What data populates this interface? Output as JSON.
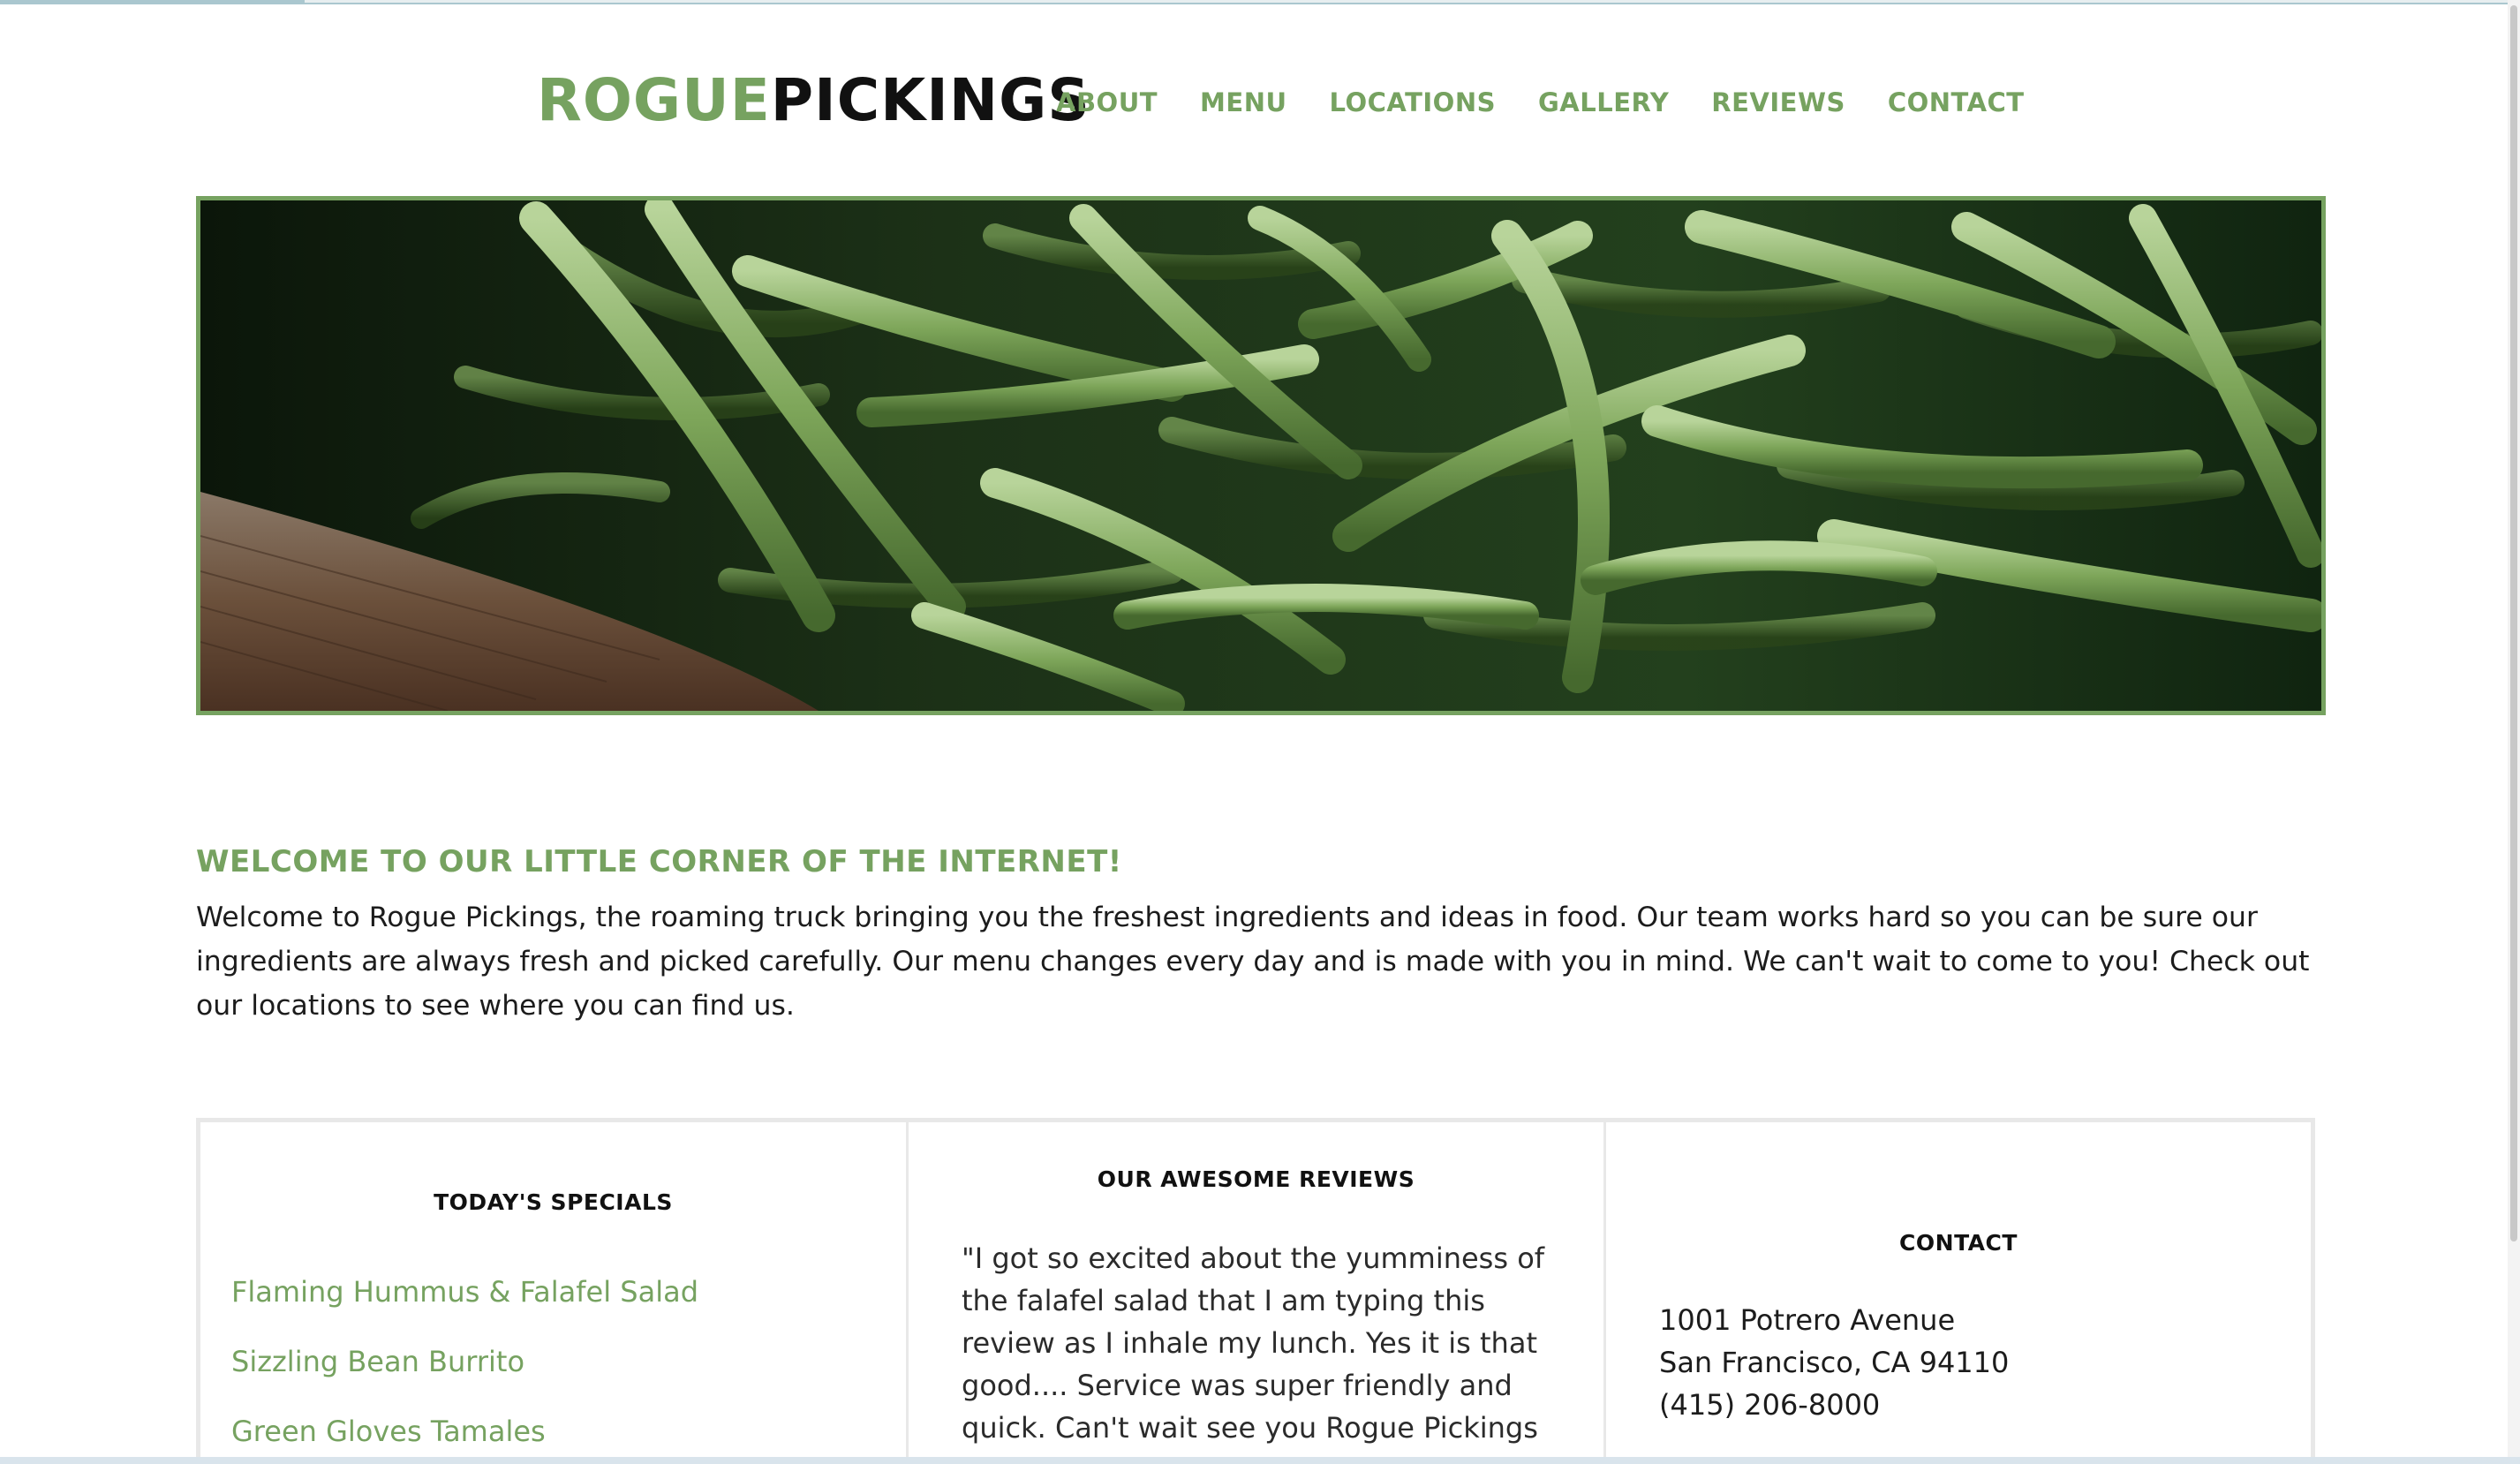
{
  "header": {
    "logo_part1": "ROGUE",
    "logo_part2": "PICKINGS",
    "nav": [
      "ABOUT",
      "MENU",
      "LOCATIONS",
      "GALLERY",
      "REVIEWS",
      "CONTACT"
    ]
  },
  "hero": {
    "image_subject": "green beans in wooden crate"
  },
  "welcome": {
    "title": "WELCOME TO OUR LITTLE CORNER OF THE INTERNET!",
    "body": "Welcome to Rogue Pickings, the roaming truck bringing you the freshest ingredients and ideas in food. Our team works hard so you can be sure our ingredients are always fresh and picked carefully. Our menu changes every day and is made with you in mind. We can't wait to come to you! Check out our locations to see where you can find us."
  },
  "specials": {
    "title": "TODAY'S SPECIALS",
    "items": [
      "Flaming Hummus & Falafel Salad",
      "Sizzling Bean Burrito",
      "Green Gloves Tamales"
    ]
  },
  "reviews": {
    "title": "OUR AWESOME REVIEWS",
    "text": "\"I got so excited about the yumminess of the falafel salad that I am typing this review as I inhale my lunch. Yes it is that good.... Service was super friendly and quick. Can't wait see you Rogue Pickings"
  },
  "contact": {
    "title": "CONTACT",
    "address_line1": "1001 Potrero Avenue",
    "address_line2": "San Francisco, CA 94110",
    "phone": "(415) 206-8000"
  },
  "colors": {
    "accent": "#76a260",
    "text": "#1c1c1c"
  }
}
